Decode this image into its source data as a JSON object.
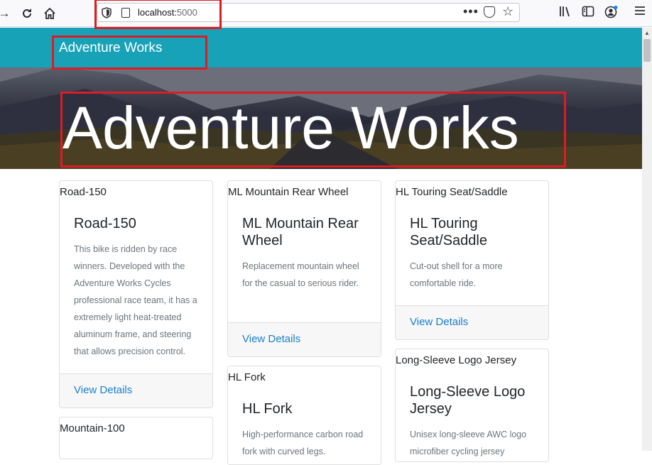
{
  "browser": {
    "url_host": "localhost:",
    "url_port": "5000",
    "icons": {
      "forward": "forward-arrow-icon",
      "reload": "reload-icon",
      "home": "home-icon",
      "shield": "tracking-shield-icon",
      "page": "page-icon",
      "more": "more-dots-icon",
      "pocket": "pocket-icon",
      "bookmark": "star-icon",
      "library": "library-icon",
      "sidebar": "sidebar-icon",
      "account": "account-icon",
      "menu": "hamburger-menu-icon"
    },
    "highlight_color": "#dd1c25"
  },
  "navbar": {
    "brand": "Adventure Works",
    "background": "#17a2b8"
  },
  "hero": {
    "title": "Adventure Works"
  },
  "products": [
    {
      "header": "Road-150",
      "title": "Road-150",
      "description": "This bike is ridden by race winners. Developed with the Adventure Works Cycles professional race team, it has a extremely light heat-treated aluminum frame, and steering that allows precision control.",
      "link": "View Details"
    },
    {
      "header": "ML Mountain Rear Wheel",
      "title": "ML Mountain Rear Wheel",
      "description": "Replacement mountain wheel for the casual to serious rider.",
      "link": "View Details"
    },
    {
      "header": "HL Touring Seat/Saddle",
      "title": "HL Touring Seat/Saddle",
      "description": "Cut-out shell for a more comfortable ride.",
      "link": "View Details"
    },
    {
      "header": "Mountain-100"
    },
    {
      "header": "HL Fork",
      "title": "HL Fork",
      "description": "High-performance carbon road fork with curved legs."
    },
    {
      "header": "Long-Sleeve Logo Jersey",
      "title": "Long-Sleeve Logo Jersey",
      "description": "Unisex long-sleeve AWC logo microfiber cycling jersey"
    }
  ]
}
